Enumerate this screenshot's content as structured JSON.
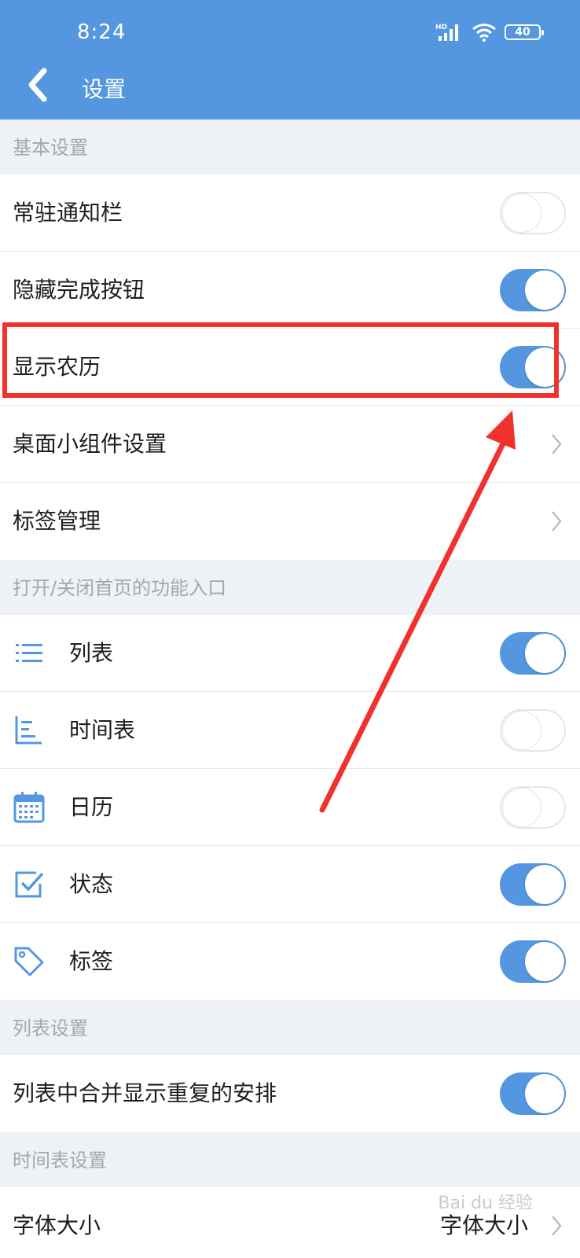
{
  "status_bar": {
    "time": "8:24",
    "signal_label": "HD",
    "battery": "40"
  },
  "header": {
    "title": "设置"
  },
  "sections": {
    "basic": {
      "label": "基本设置"
    },
    "entries": {
      "label": "打开/关闭首页的功能入口"
    },
    "list": {
      "label": "列表设置"
    },
    "timetable": {
      "label": "时间表设置"
    }
  },
  "rows": {
    "resident_notification": {
      "label": "常驻通知栏",
      "toggle": "off"
    },
    "hide_done_button": {
      "label": "隐藏完成按钮",
      "toggle": "on"
    },
    "show_lunar": {
      "label": "显示农历",
      "toggle": "on"
    },
    "widget_settings": {
      "label": "桌面小组件设置"
    },
    "tag_management": {
      "label": "标签管理"
    },
    "entry_list": {
      "label": "列表",
      "icon": "list-icon",
      "toggle": "on"
    },
    "entry_timetable": {
      "label": "时间表",
      "icon": "timeline-icon",
      "toggle": "off"
    },
    "entry_calendar": {
      "label": "日历",
      "icon": "calendar-icon",
      "toggle": "off"
    },
    "entry_status": {
      "label": "状态",
      "icon": "checkbox-icon",
      "toggle": "on"
    },
    "entry_tags": {
      "label": "标签",
      "icon": "tag-icon",
      "toggle": "on"
    },
    "merge_repeat": {
      "label": "列表中合并显示重复的安排",
      "toggle": "on"
    },
    "font_size": {
      "label": "字体大小",
      "value": "字体大小"
    }
  },
  "annotation": {
    "highlight_color": "#f0312e"
  },
  "watermark": {
    "text": "Bai du 经验"
  },
  "colors": {
    "accent": "#5497e0",
    "background": "#eef1f6"
  }
}
